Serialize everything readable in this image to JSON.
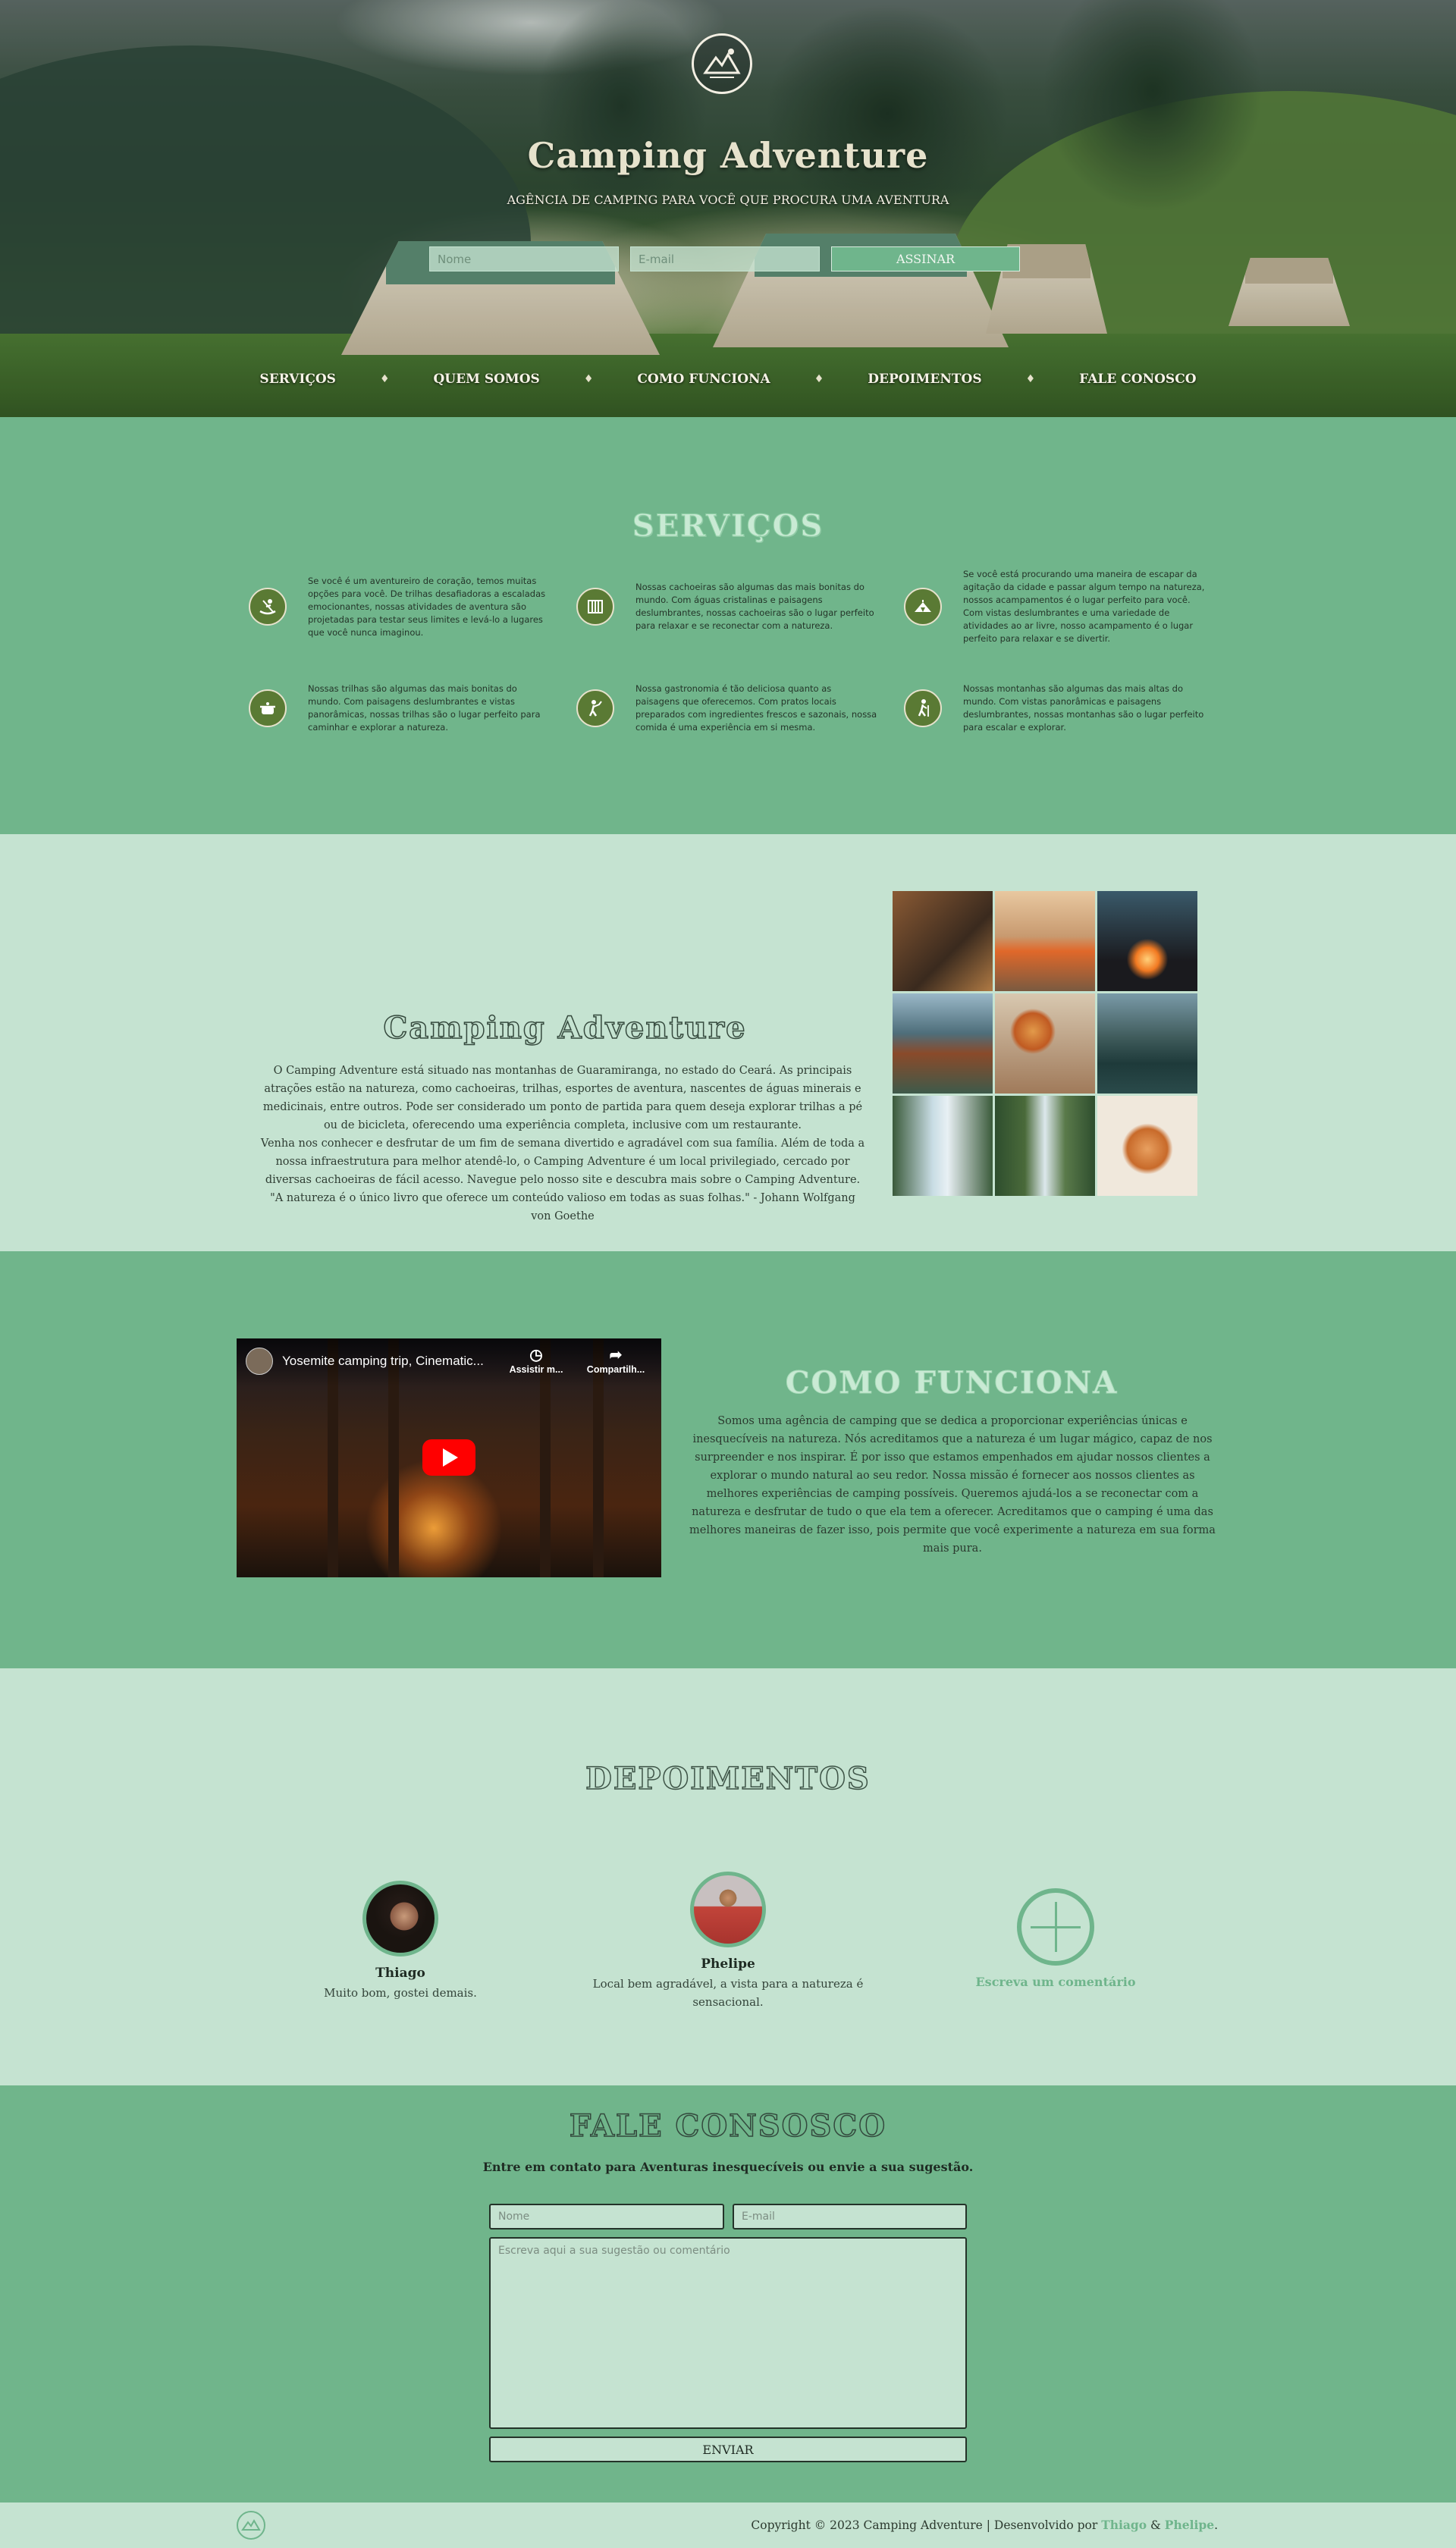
{
  "hero": {
    "title": "Camping Adventure",
    "subtitle": "AGÊNCIA DE CAMPING PARA VOCÊ QUE PROCURA UMA AVENTURA",
    "name_placeholder": "Nome",
    "email_placeholder": "E-mail",
    "subscribe_label": "ASSINAR"
  },
  "nav": {
    "items": [
      "SERVIÇOS",
      "QUEM SOMOS",
      "COMO FUNCIONA",
      "DEPOIMENTOS",
      "FALE CONOSCO"
    ],
    "separator": "♦"
  },
  "services": {
    "title": "SERVIÇOS",
    "items": [
      {
        "icon": "kayak-icon",
        "text": "Se você é um aventureiro de coração, temos muitas opções para você. De trilhas desafiadoras a escaladas emocionantes, nossas atividades de aventura são projetadas para testar seus limites e levá-lo a lugares que você nunca imaginou."
      },
      {
        "icon": "waterfall-icon",
        "text": "Nossas cachoeiras são algumas das mais bonitas do mundo. Com águas cristalinas e paisagens deslumbrantes, nossas cachoeiras são o lugar perfeito para relaxar e se reconectar com a natureza."
      },
      {
        "icon": "tent-icon",
        "text": "Se você está procurando uma maneira de escapar da agitação da cidade e passar algum tempo na natureza, nossos acampamentos é o lugar perfeito para você. Com vistas deslumbrantes e uma variedade de atividades ao ar livre, nosso acampamento é o lugar perfeito para relaxar e se divertir."
      },
      {
        "icon": "cooking-pot-icon",
        "text": "Nossas trilhas são algumas das mais bonitas do mundo. Com paisagens deslumbrantes e vistas panorâmicas, nossas trilhas são o lugar perfeito para caminhar e explorar a natureza."
      },
      {
        "icon": "chef-icon",
        "text": "Nossa gastronomia é tão deliciosa quanto as paisagens que oferecemos. Com pratos locais preparados com ingredientes frescos e sazonais, nossa comida é uma experiência em si mesma."
      },
      {
        "icon": "hiker-icon",
        "text": "Nossas montanhas são algumas das mais altas do mundo. Com vistas panorâmicas e paisagens deslumbrantes, nossas montanhas são o lugar perfeito para escalar e explorar."
      }
    ]
  },
  "about": {
    "title": "Camping Adventure",
    "text": "O Camping Adventure está situado nas montanhas de Guaramiranga, no estado do Ceará. As principais atrações estão na natureza, como cachoeiras, trilhas, esportes de aventura, nascentes de águas minerais e medicinais, entre outros. Pode ser considerado um ponto de partida para quem deseja explorar trilhas a pé ou de bicicleta, oferecendo uma experiência completa, inclusive com um restaurante.\nVenha nos conhecer e desfrutar de um fim de semana divertido e agradável com sua família. Além de toda a nossa infraestrutura para melhor atendê-lo, o Camping Adventure é um local privilegiado, cercado por diversas cachoeiras de fácil acesso. Navegue pelo nosso site e descubra mais sobre o Camping Adventure. \"A natureza é o único livro que oferece um conteúdo valioso em todas as suas folhas.\" - Johann Wolfgang von Goethe"
  },
  "how": {
    "title": "COMO FUNCIONA",
    "video_title": "Yosemite camping trip, Cinematic...",
    "watch_later": "Assistir m...",
    "share": "Compartilh...",
    "text": "Somos uma agência de camping que se dedica a proporcionar experiências únicas e inesquecíveis na natureza. Nós acreditamos que a natureza é um lugar mágico, capaz de nos surpreender e nos inspirar. É por isso que estamos empenhados em ajudar nossos clientes a explorar o mundo natural ao seu redor. Nossa missão é fornecer aos nossos clientes as melhores experiências de camping possíveis. Queremos ajudá-los a se reconectar com a natureza e desfrutar de tudo o que ela tem a oferecer. Acreditamos que o camping é uma das melhores maneiras de fazer isso, pois permite que você experimente a natureza em sua forma mais pura."
  },
  "testimonials": {
    "title": "DEPOIMENTOS",
    "people": [
      {
        "name": "Thiago",
        "quote": "Muito bom, gostei demais."
      },
      {
        "name": "Phelipe",
        "quote": "Local bem agradável, a vista para a natureza é sensacional."
      }
    ],
    "add_label": "Escreva um comentário"
  },
  "contact": {
    "title": "FALE CONSOSCO",
    "subtitle": "Entre em contato para Aventuras inesquecíveis ou envie a sua sugestão.",
    "name_placeholder": "Nome",
    "email_placeholder": "E-mail",
    "message_placeholder": "Escreva aqui a sua sugestão ou comentário",
    "send_label": "ENVIAR"
  },
  "footer": {
    "copyright": "Copyright © 2023 Camping Adventure | Desenvolvido por",
    "dev1": "Thiago",
    "and": "&",
    "dev2": "Phelipe",
    "end": "."
  },
  "colors": {
    "primary_green": "#70b58b",
    "light_green": "#c5e3d1",
    "accent_green": "#6fb58c",
    "icon_olive": "#5a7a34"
  }
}
